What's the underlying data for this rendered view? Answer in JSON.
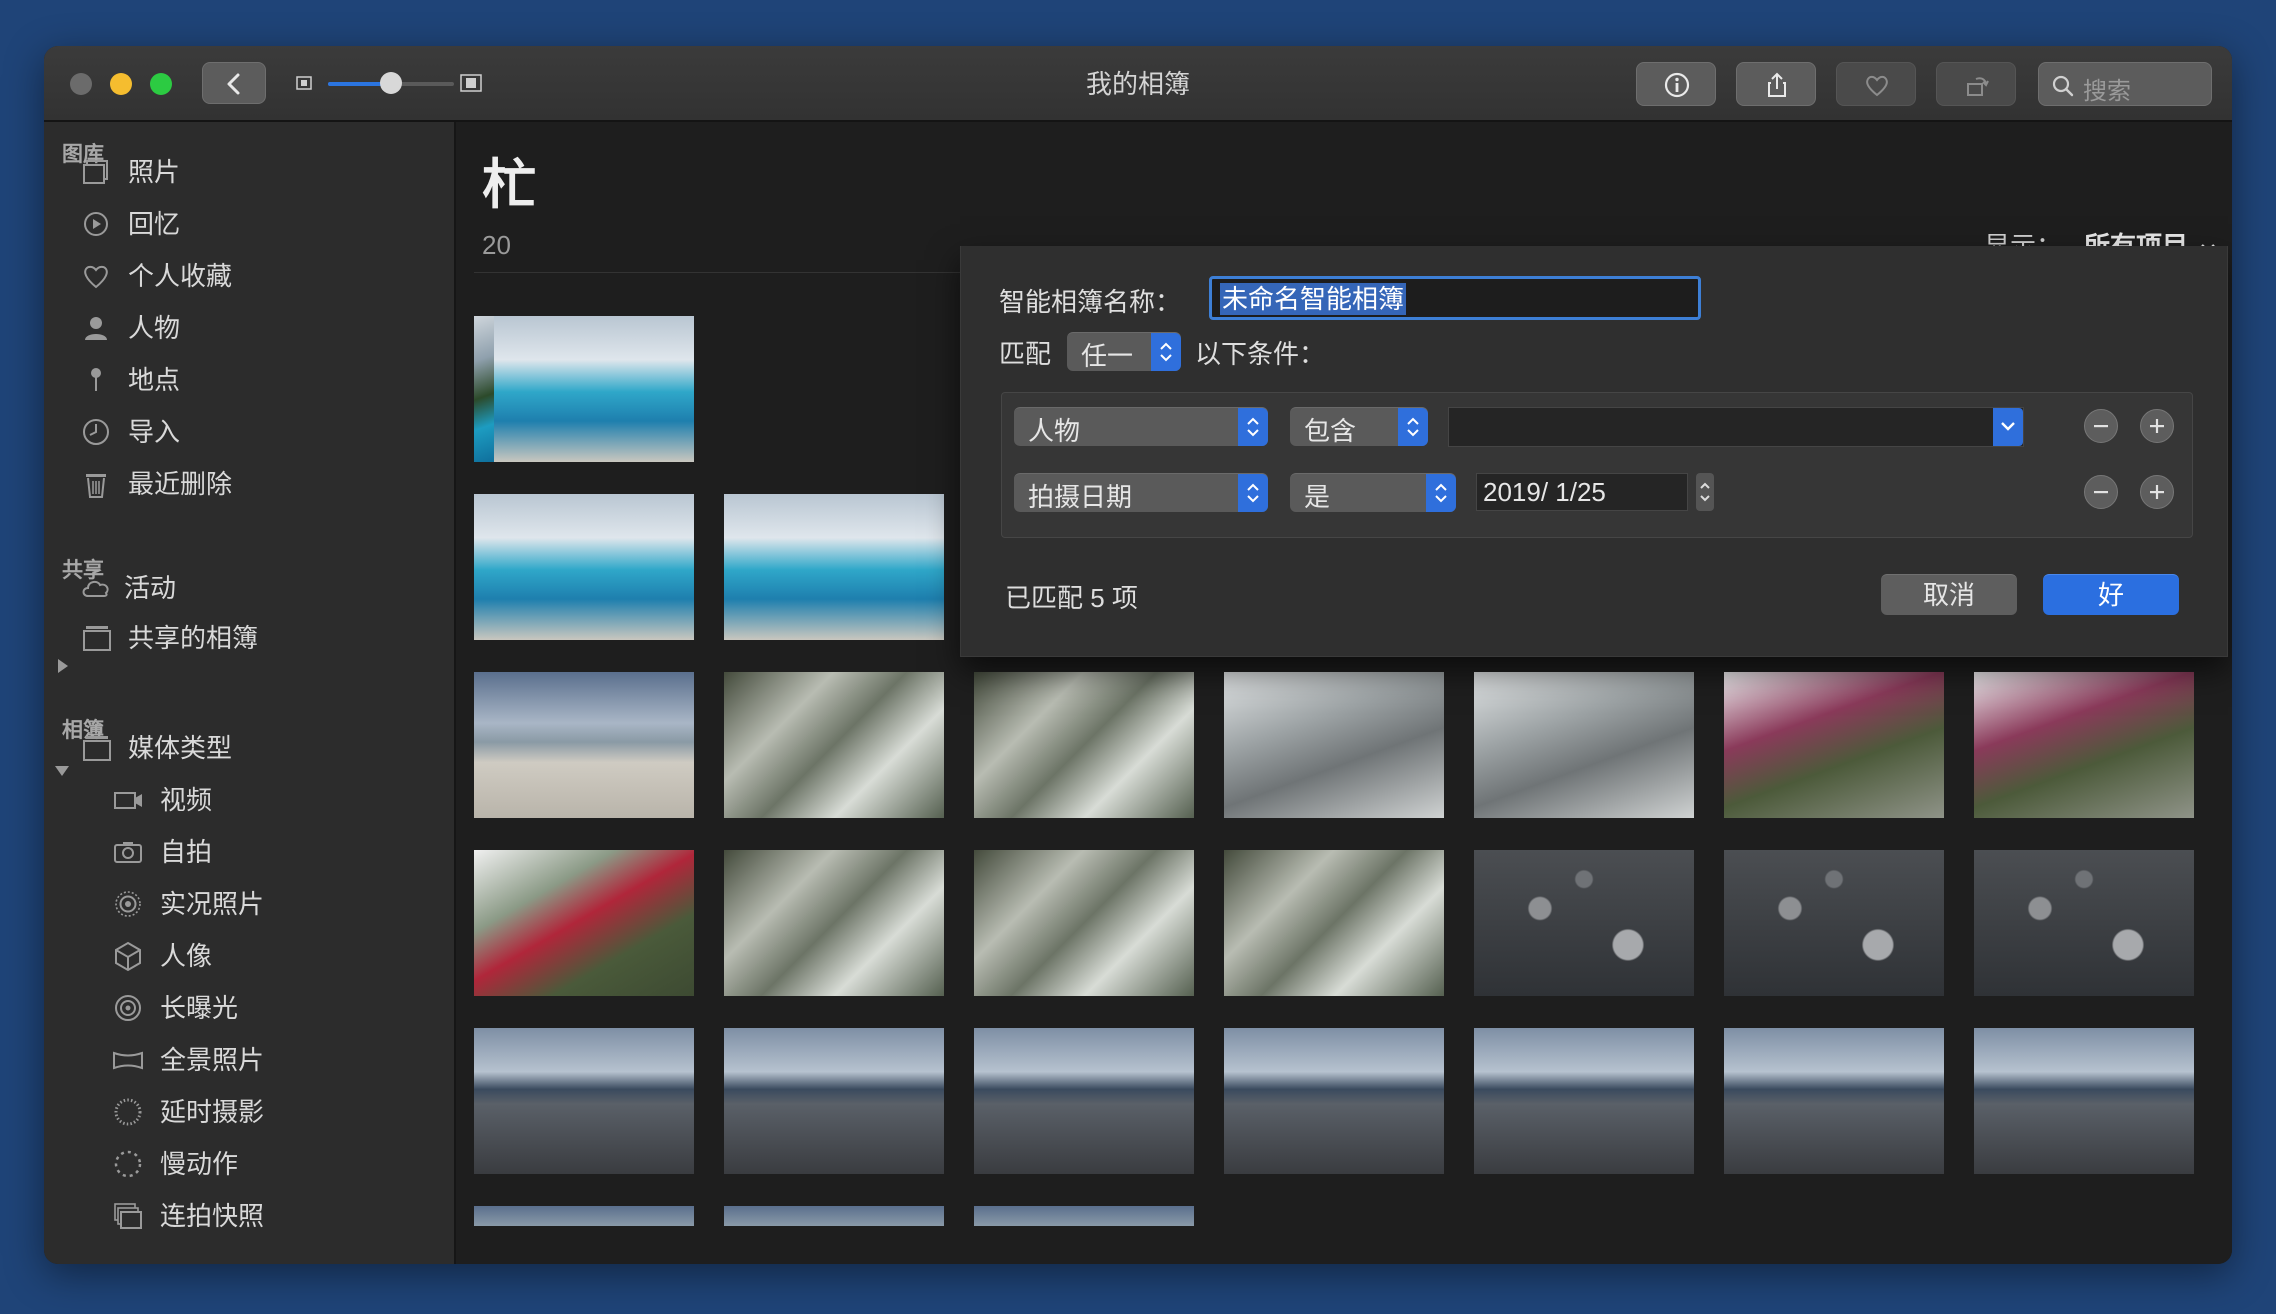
{
  "window": {
    "title": "我的相簿"
  },
  "toolbar": {
    "search_placeholder": "搜索",
    "zoom_level": 0.5
  },
  "sidebar": {
    "sections": [
      {
        "title": "图库",
        "items": [
          {
            "label": "照片",
            "icon": "photos-icon"
          },
          {
            "label": "回忆",
            "icon": "memories-icon"
          },
          {
            "label": "个人收藏",
            "icon": "heart-icon"
          },
          {
            "label": "人物",
            "icon": "person-icon"
          },
          {
            "label": "地点",
            "icon": "pin-icon"
          },
          {
            "label": "导入",
            "icon": "clock-icon"
          },
          {
            "label": "最近删除",
            "icon": "trash-icon"
          }
        ]
      },
      {
        "title": "共享",
        "items": [
          {
            "label": "活动",
            "icon": "cloud-icon"
          },
          {
            "label": "共享的相簿",
            "icon": "album-stack-icon"
          }
        ]
      },
      {
        "title": "相簿",
        "items": [
          {
            "label": "媒体类型",
            "icon": "album-stack-icon"
          },
          {
            "label": "视频",
            "icon": "video-icon"
          },
          {
            "label": "自拍",
            "icon": "camera-icon"
          },
          {
            "label": "实况照片",
            "icon": "live-photo-icon"
          },
          {
            "label": "人像",
            "icon": "cube-icon"
          },
          {
            "label": "长曝光",
            "icon": "long-exposure-icon"
          },
          {
            "label": "全景照片",
            "icon": "panorama-icon"
          },
          {
            "label": "延时摄影",
            "icon": "timelapse-icon"
          },
          {
            "label": "慢动作",
            "icon": "slomo-icon"
          },
          {
            "label": "连拍快照",
            "icon": "burst-icon"
          }
        ]
      }
    ]
  },
  "main": {
    "title_visible": "杧",
    "subtitle_visible": "20",
    "show_label": "显示：",
    "show_value": "所有项目"
  },
  "dialog": {
    "name_label": "智能相簿名称：",
    "name_value": "未命名智能相簿",
    "match_label": "匹配",
    "match_value": "任一",
    "match_suffix": "以下条件：",
    "rules": [
      {
        "field": "人物",
        "operator": "包含",
        "value": ""
      },
      {
        "field": "拍摄日期",
        "operator": "是",
        "value": "2019/  1/25"
      }
    ],
    "count_text": "已匹配 5 项",
    "cancel_label": "取消",
    "ok_label": "好"
  },
  "colors": {
    "accent": "#2b6fe0",
    "background": "#1f4478",
    "sidebar": "#2c2c2c",
    "content": "#1e1e1e"
  }
}
